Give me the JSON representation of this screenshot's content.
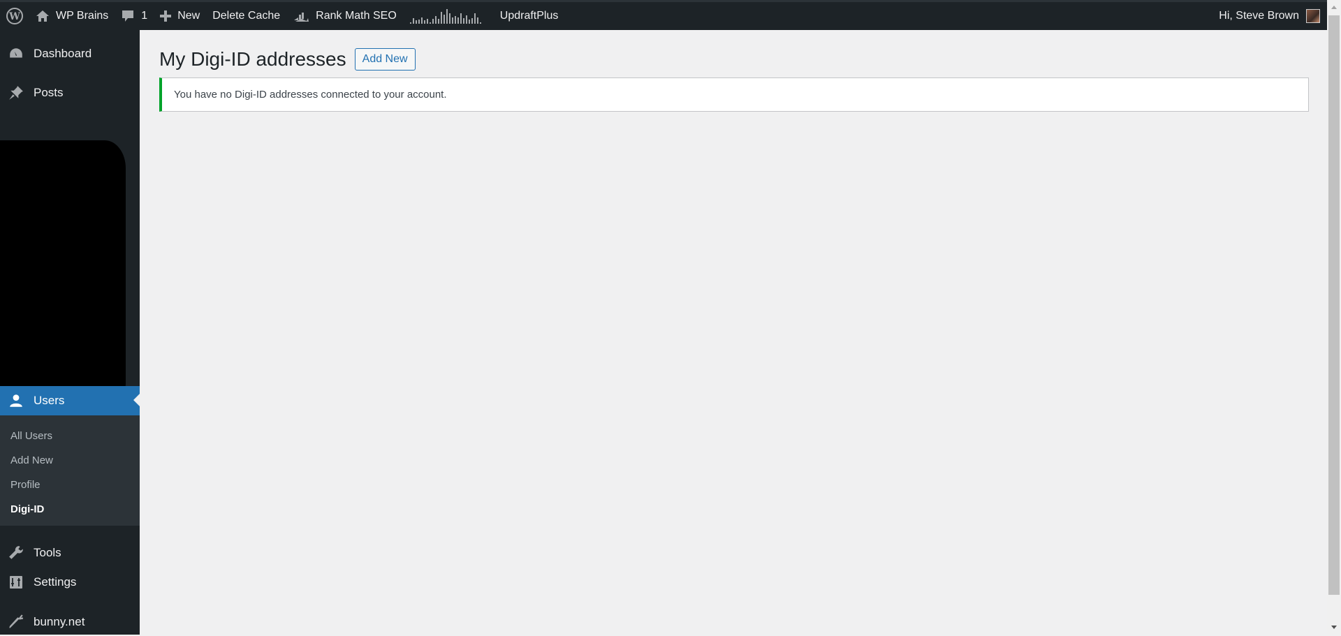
{
  "adminbar": {
    "wp_logo": "wordpress-logo-icon",
    "site_name": "WP Brains",
    "comments_count": "1",
    "new_label": "New",
    "delete_cache": "Delete Cache",
    "rank_math": "Rank Math SEO",
    "updraft": "UpdraftPlus",
    "greeting": "Hi, Steve Brown"
  },
  "sidebar": {
    "items": [
      {
        "label": "Dashboard",
        "icon": "dashboard-icon"
      },
      {
        "label": "Posts",
        "icon": "pin-icon"
      },
      {
        "label": "Users",
        "icon": "user-icon",
        "active": true
      },
      {
        "label": "Tools",
        "icon": "wrench-icon"
      },
      {
        "label": "Settings",
        "icon": "settings-icon"
      },
      {
        "label": "bunny.net",
        "icon": "carrot-icon"
      }
    ],
    "users_submenu": [
      "All Users",
      "Add New",
      "Profile",
      "Digi-ID"
    ],
    "current_submenu": "Digi-ID",
    "redacted": true
  },
  "main": {
    "title": "My Digi-ID addresses",
    "add_new_label": "Add New",
    "notice": "You have no Digi-ID addresses connected to your account.",
    "notice_color": "#00a32a"
  },
  "colors": {
    "adminbar_bg": "#1d2327",
    "accent": "#2271b1"
  }
}
